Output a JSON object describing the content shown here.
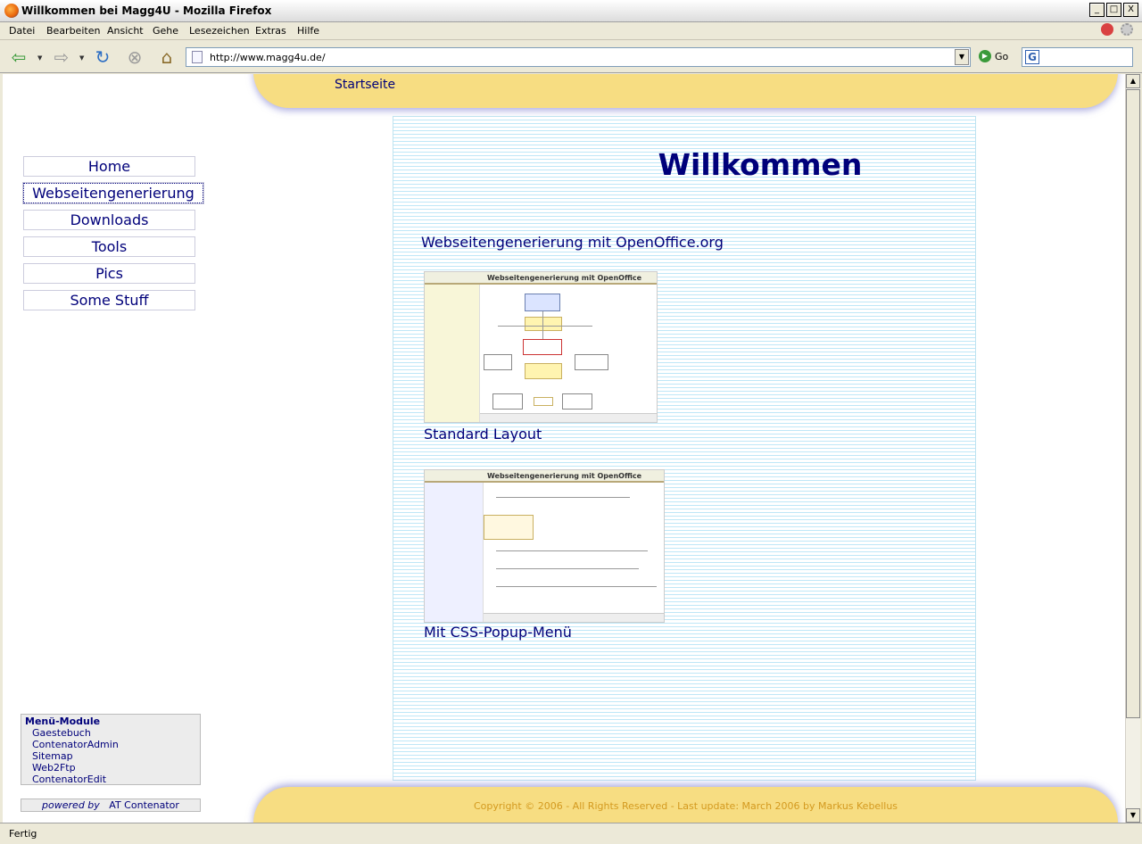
{
  "window": {
    "title": "Willkommen bei Magg4U - Mozilla Firefox",
    "buttons": {
      "minimize": "_",
      "maximize": "□",
      "close": "X"
    }
  },
  "menubar": {
    "items": [
      "Datei",
      "Bearbeiten",
      "Ansicht",
      "Gehe",
      "Lesezeichen",
      "Extras",
      "Hilfe"
    ]
  },
  "navbar": {
    "url": "http://www.magg4u.de/",
    "go_label": "Go",
    "search_icon": "G"
  },
  "page": {
    "top_banner": "Startseite",
    "heading": "Willkommen",
    "subheading": "Webseitengenerierung mit OpenOffice.org",
    "thumb1_title": "Webseitengenerierung mit OpenOffice",
    "thumb1_caption": "Standard Layout",
    "thumb2_title": "Webseitengenerierung mit OpenOffice",
    "thumb2_caption": "Mit CSS-Popup-Menü",
    "sidenav": [
      "Home",
      "Webseitengenerierung",
      "Downloads",
      "Tools",
      "Pics",
      "Some Stuff"
    ],
    "modules": {
      "title": "Menü-Module",
      "links": [
        "Gaestebuch",
        "ContenatorAdmin",
        "Sitemap",
        "Web2Ftp",
        "ContenatorEdit"
      ]
    },
    "powered": {
      "prefix": "powered by",
      "name": "AT Contenator"
    },
    "footer": "Copyright © 2006 - All Rights Reserved - Last update: March 2006 by Markus Kebellus"
  },
  "statusbar": {
    "text": "Fertig"
  },
  "colors": {
    "accent": "#00007a",
    "banner": "#f7dd82",
    "footer_text": "#d49a1f",
    "stripes": "#bfe7f7"
  }
}
